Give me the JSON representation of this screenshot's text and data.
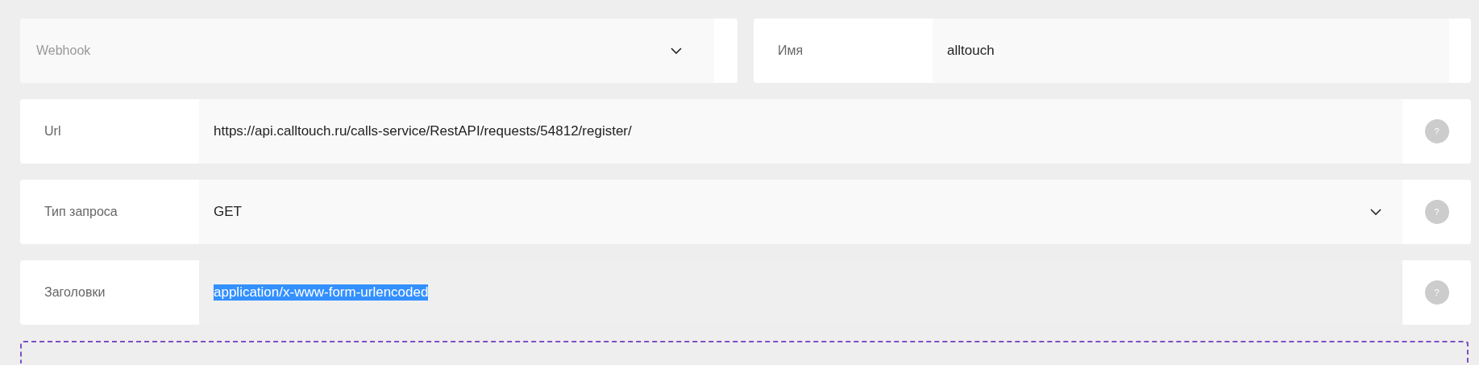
{
  "top_row": {
    "type_select": {
      "placeholder": "Webhook"
    },
    "name_field": {
      "label": "Имя",
      "value": "alltouch"
    }
  },
  "rows": [
    {
      "label": "Url",
      "kind": "input",
      "value": "https://api.calltouch.ru/calls-service/RestAPI/requests/54812/register/",
      "text_selected": false,
      "help": "?"
    },
    {
      "label": "Тип запроса",
      "kind": "select",
      "value": "GET",
      "text_selected": false,
      "help": "?"
    },
    {
      "label": "Заголовки",
      "kind": "input",
      "value": "application/x-www-form-urlencoded",
      "text_selected": true,
      "help": "?"
    }
  ]
}
